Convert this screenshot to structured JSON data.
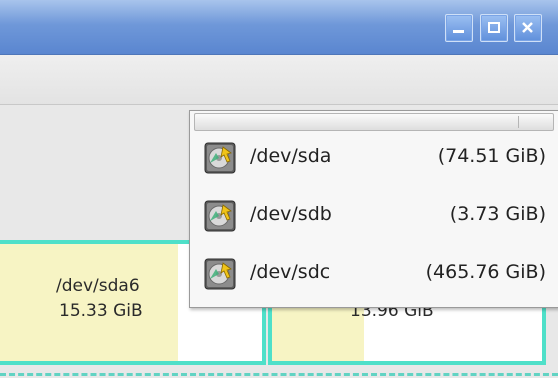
{
  "window": {
    "controls": [
      "minimize-icon",
      "maximize-icon",
      "close-icon"
    ]
  },
  "partitions": [
    {
      "name": "/dev/sda6",
      "size": "15.33 GiB"
    },
    {
      "name": "",
      "size": "13.96 GiB"
    }
  ],
  "device_menu": {
    "items": [
      {
        "label": "/dev/sda",
        "size": "(74.51 GiB)",
        "icon": "harddisk-icon"
      },
      {
        "label": "/dev/sdb",
        "size": "(3.73 GiB)",
        "icon": "harddisk-icon"
      },
      {
        "label": "/dev/sdc",
        "size": "(465.76 GiB)",
        "icon": "harddisk-icon"
      }
    ]
  },
  "colors": {
    "titlebar": "#6f98d9",
    "partition_border": "#4fe0c9",
    "used_fill": "#f7f4c4"
  }
}
